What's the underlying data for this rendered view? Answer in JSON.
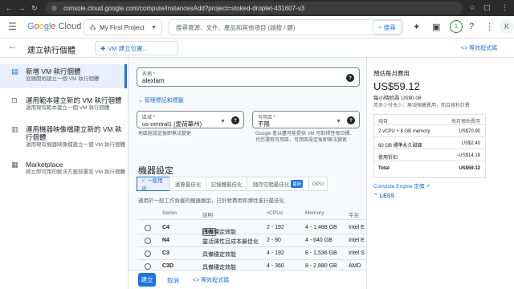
{
  "browser": {
    "url": "console.cloud.google.com/compute/instancesAdd?project=stoked-droplet-431607-v3"
  },
  "header": {
    "logo_parts": [
      "G",
      "o",
      "o",
      "g",
      "l",
      "e",
      " Cloud"
    ],
    "project": "My First Project",
    "search_placeholder": "搜尋資源、文件、產品和其他項目 (請按 / 鍵)",
    "search_button": "搜尋",
    "notification_count": "1",
    "avatar_letter": "K"
  },
  "subheader": {
    "title": "建立執行個體",
    "compare_button": "VM 建立位置...",
    "pricing_link": "等效程式碼"
  },
  "sidebar": {
    "items": [
      {
        "title": "新增 VM 執行個體",
        "desc": "從頭開始建立一個 VM 執行個體"
      },
      {
        "title": "運用範本建立新的 VM 執行個體",
        "desc": "運用現有範本建立一個 VM 執行個體"
      },
      {
        "title": "運用機器映像檔建立新的 VM 執行個體",
        "desc": "運用現有機器映像檔建立一個 VM 執行個體"
      },
      {
        "title": "Marketplace",
        "desc": "將立即可用的解決方案部署至 VM 執行個體"
      }
    ]
  },
  "form": {
    "name_label": "名稱 *",
    "name_value": "alexlam",
    "labels_link": "管理標記和標籤",
    "region_label": "區域 *",
    "region_value": "us-central1 (愛荷華州)",
    "region_hint": "地區經設定後即無法變更",
    "zone_label": "可用區 *",
    "zone_value": "不限",
    "zone_hint": "Google 會以盡可能提供 VM 可取得性每日標、代您選取可用區，可用區設定後即無法變更",
    "section_title": "機器設定",
    "tabs": [
      "✓ 一般用途",
      "運算最佳化",
      "記憶體最佳化",
      "儲存空間最佳化",
      "最新",
      "GPU"
    ],
    "tab_desc": "適用於一般工作負載的機器類型，已針對費用和彈性進行最佳化",
    "table_headers": [
      "Series",
      "說明",
      "vCPUs",
      "Memory",
      "平台"
    ],
    "rows": [
      {
        "series": "C4",
        "badge": "預覽",
        "desc": "具備穩定效能",
        "vcpus": "2 - 192",
        "memory": "4 - 1,488 GB",
        "platform": "Intel E"
      },
      {
        "series": "N4",
        "badge": "",
        "desc": "靈活彈性且成本最佳化",
        "vcpus": "2 - 80",
        "memory": "4 - 640 GB",
        "platform": "Intel E"
      },
      {
        "series": "C3",
        "badge": "",
        "desc": "具備穩定效能",
        "vcpus": "4 - 192",
        "memory": "8 - 1,536 GB",
        "platform": "Intel S"
      },
      {
        "series": "C3D",
        "badge": "",
        "desc": "具備穩定效能",
        "vcpus": "4 - 360",
        "memory": "8 - 2,880 GB",
        "platform": "AMD"
      }
    ]
  },
  "pricing": {
    "title": "預估每月費用",
    "monthly": "US$59.12",
    "hourly": "每小時約為 US$0.08",
    "note": "用多少付多少：無須預繳費用，而且按秒計費",
    "table_head": [
      "項目",
      "每月預估費用"
    ],
    "rows": [
      {
        "item": "2 vCPU + 8 GB memory",
        "cost": "US$70.90"
      },
      {
        "item": "60 GB 標準永久磁碟",
        "cost": "US$2.40"
      },
      {
        "item": "使用折扣",
        "cost": "-US$14.18"
      },
      {
        "item": "Total",
        "cost": "US$59.12"
      }
    ],
    "link": "Compute Engine 定價",
    "less": "LESS"
  },
  "footer": {
    "create": "建立",
    "cancel": "取消",
    "equivalent": "等效程式碼"
  }
}
